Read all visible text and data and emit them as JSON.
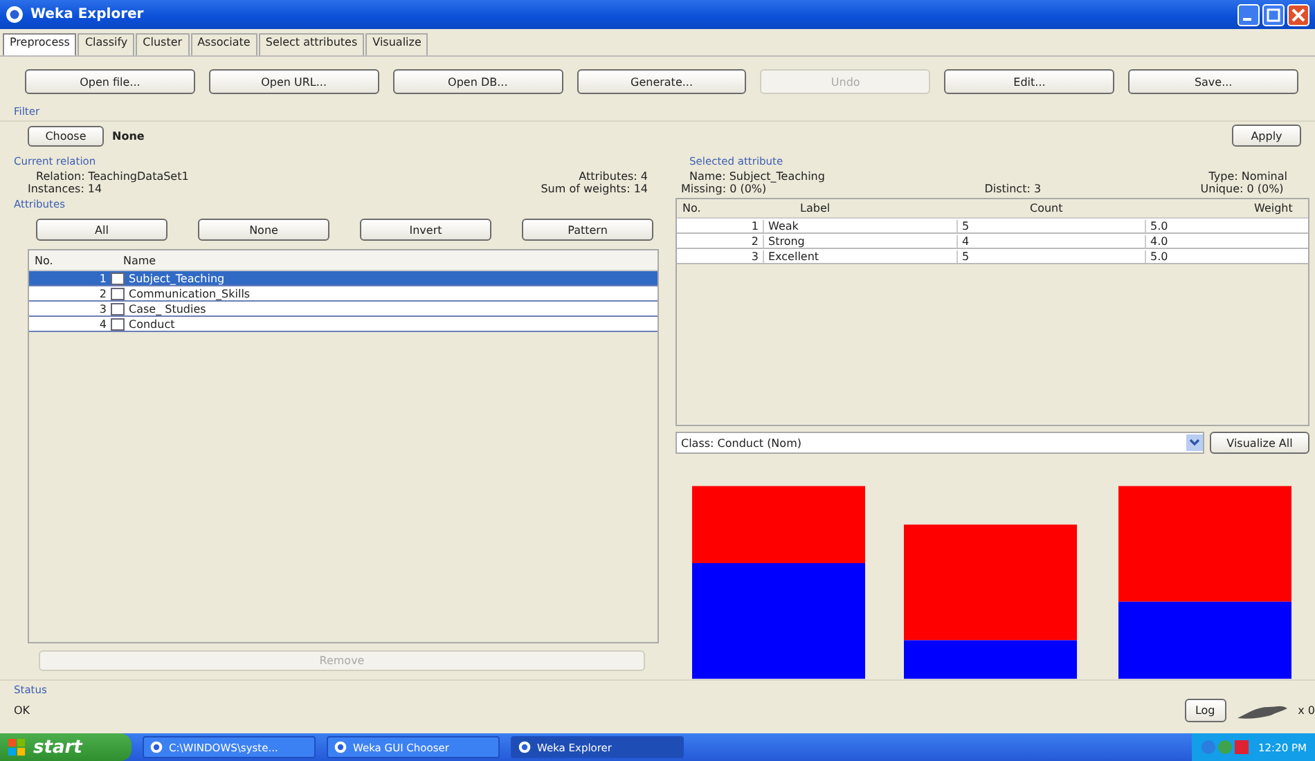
{
  "window": {
    "title": "Weka Explorer"
  },
  "tabs": [
    {
      "label": "Preprocess",
      "selected": true
    },
    {
      "label": "Classify",
      "selected": false
    },
    {
      "label": "Cluster",
      "selected": false
    },
    {
      "label": "Associate",
      "selected": false
    },
    {
      "label": "Select attributes",
      "selected": false
    },
    {
      "label": "Visualize",
      "selected": false
    }
  ],
  "toolbar": [
    {
      "label": "Open file...",
      "disabled": false
    },
    {
      "label": "Open URL...",
      "disabled": false
    },
    {
      "label": "Open DB...",
      "disabled": false
    },
    {
      "label": "Generate...",
      "disabled": false
    },
    {
      "label": "Undo",
      "disabled": true
    },
    {
      "label": "Edit...",
      "disabled": false
    },
    {
      "label": "Save...",
      "disabled": false
    }
  ],
  "filter": {
    "title": "Filter",
    "choose": "Choose",
    "value": "None",
    "apply": "Apply"
  },
  "current_relation": {
    "title": "Current relation",
    "relation": "Relation: TeachingDataSet1",
    "instances": "Instances: 14",
    "attributes": "Attributes: 4",
    "sum_of_weights": "Sum of weights: 14"
  },
  "attributes": {
    "title": "Attributes",
    "buttons": [
      "All",
      "None",
      "Invert",
      "Pattern"
    ],
    "columns": [
      "No.",
      "Name"
    ],
    "rows": [
      {
        "no": "1",
        "name": "Subject_Teaching",
        "checked": false,
        "selected": true
      },
      {
        "no": "2",
        "name": "Communication_Skills",
        "checked": false,
        "selected": false
      },
      {
        "no": "3",
        "name": "Case_ Studies",
        "checked": false,
        "selected": false
      },
      {
        "no": "4",
        "name": "Conduct",
        "checked": false,
        "selected": false
      }
    ],
    "remove": {
      "label": "Remove",
      "disabled": true
    }
  },
  "selected_attribute": {
    "title": "Selected attribute",
    "name": "Name: Subject_Teaching",
    "missing": "Missing: 0 (0%)",
    "distinct": "Distinct: 3",
    "type": "Type: Nominal",
    "unique": "Unique: 0 (0%)",
    "columns": [
      "No.",
      "Label",
      "Count",
      "Weight"
    ],
    "rows": [
      {
        "no": "1",
        "label": "Weak",
        "count": "5",
        "weight": "5.0"
      },
      {
        "no": "2",
        "label": "Strong",
        "count": "4",
        "weight": "4.0"
      },
      {
        "no": "3",
        "label": "Excellent",
        "count": "5",
        "weight": "5.0"
      }
    ]
  },
  "class_selector": {
    "value": "Class: Conduct (Nom)",
    "button": "Visualize All"
  },
  "status": {
    "title": "Status",
    "text": "OK",
    "log": "Log",
    "count": "x 0"
  },
  "taskbar": {
    "start": "start",
    "tasks": [
      {
        "label": "C:\\WINDOWS\\syste...",
        "selected": false
      },
      {
        "label": "Weka GUI Chooser",
        "selected": false
      },
      {
        "label": "Weka Explorer",
        "selected": true
      }
    ],
    "clock": "12:20 PM"
  }
}
